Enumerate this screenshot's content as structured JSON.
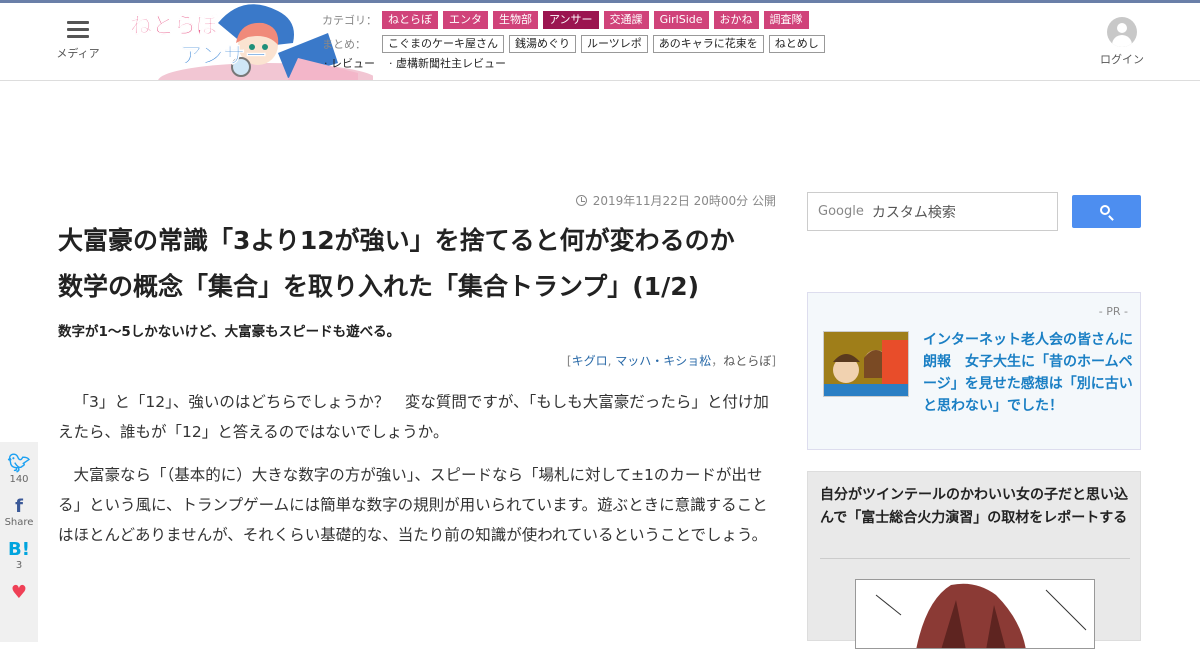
{
  "header": {
    "menu_label": "メディア",
    "login_label": "ログイン",
    "nav": {
      "category_label": "カテゴリ：",
      "categories": [
        "ねとらぼ",
        "エンタ",
        "生物部",
        "アンサー",
        "交通課",
        "GirlSide",
        "おかね",
        "調査隊"
      ],
      "active_category": "アンサー",
      "summary_label": "まとめ：",
      "summaries": [
        "こぐまのケーキ屋さん",
        "銭湯めぐり",
        "ルーツレポ",
        "あのキャラに花束を",
        "ねとめし"
      ],
      "extra_links": [
        "· レビュー",
        "· 虚構新聞社主レビュー"
      ]
    }
  },
  "article": {
    "date": "2019年11月22日 20時00分 公開",
    "title": "大富豪の常識「3より12が強い」を捨てると何が変わるのか　数学の概念「集合」を取り入れた「集合トランプ」(1/2)",
    "subtitle": "数字が1～5しかないけど、大富豪もスピードも遊べる。",
    "byline": {
      "open": "[",
      "author1": "キグロ",
      "author2": "マッハ・キショ松",
      "publisher": "ねとらぼ",
      "close": "]"
    },
    "paragraphs": [
      "「3」と「12」、強いのはどちらでしょうか？　変な質問ですが、「もしも大富豪だったら」と付け加えたら、誰もが「12」と答えるのではないでしょうか。",
      "大富豪なら「（基本的に）大きな数字の方が強い」、スピードなら「場札に対して±1のカードが出せる」という風に、トランプゲームには簡単な数字の規則が用いられています。遊ぶときに意識することはほとんどありませんが、それくらい基礎的な、当たり前の知識が使われているということでしょう。"
    ]
  },
  "share": {
    "twitter_count": "140",
    "facebook_label": "Share",
    "hatena_label": "B!",
    "hatena_count": "3"
  },
  "sidebar": {
    "search_brand": "Google",
    "search_placeholder": "カスタム検索",
    "pr_label": "- PR -",
    "pr_text": "インターネット老人会の皆さんに朗報　女子大生に「昔のホームページ」を見せた感想は「別に古いと思わない」でした！",
    "box_title": "自分がツインテールのかわいい女の子だと思い込んで「富士総合火力演習」の取材をレポートする"
  },
  "colors": {
    "category_bg": "#d0437a",
    "category_active_bg": "#9b1550",
    "link": "#2a6aa8",
    "pr_link": "#1a7fc4",
    "search_button": "#4d8ef0"
  }
}
